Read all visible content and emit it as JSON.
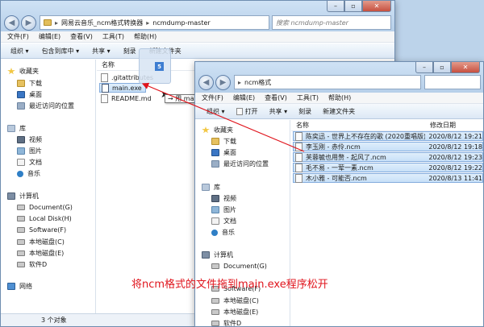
{
  "window_back": {
    "path": [
      "网易云音乐_ncm格式转换器",
      "ncmdump-master"
    ],
    "search_placeholder": "搜索 ncmdump-master",
    "menu": [
      "文件(F)",
      "编辑(E)",
      "查看(V)",
      "工具(T)",
      "帮助(H)"
    ],
    "toolbar": {
      "organize": "组织 ▾",
      "include": "包含到库中 ▾",
      "share": "共享 ▾",
      "burn": "刻录",
      "new_folder": "新建文件夹"
    },
    "column_name": "名称",
    "files": [
      ".gitattributes",
      "main.exe",
      "README.md"
    ],
    "nav": {
      "favorites": "收藏夹",
      "favorites_items": [
        "下载",
        "桌面",
        "最近访问的位置"
      ],
      "libraries": "库",
      "library_items": [
        "视频",
        "图片",
        "文档",
        "音乐"
      ],
      "computer": "计算机",
      "drives": [
        "Document(G)",
        "Local Disk(H)",
        "Software(F)",
        "本地磁盘(C)",
        "本地磁盘(E)",
        "软件D"
      ],
      "network": "网络"
    },
    "status": "3 个对象"
  },
  "window_front": {
    "path": "ncm格式",
    "menu": [
      "文件(F)",
      "编辑(E)",
      "查看(V)",
      "工具(T)",
      "帮助(H)"
    ],
    "toolbar": {
      "organize": "组织 ▾",
      "open": "打开",
      "share": "共享 ▾",
      "burn": "刻录",
      "new_folder": "新建文件夹"
    },
    "columns": {
      "name": "名称",
      "date": "修改日期"
    },
    "files": [
      {
        "name": "陈奕迅 - 世界上不存在的歌 (2020重唱版).ncm",
        "date": "2020/8/12 19:21"
      },
      {
        "name": "李玉刚 - 赤伶.ncm",
        "date": "2020/8/12 19:18"
      },
      {
        "name": "芙蓉毓也用赘 - 起风了.ncm",
        "date": "2020/8/12 19:23"
      },
      {
        "name": "毛不易 - 一荤一素.ncm",
        "date": "2020/8/12 19:22"
      },
      {
        "name": "木小雅 - 可能否.ncm",
        "date": "2020/8/13 11:41"
      }
    ],
    "nav": {
      "favorites": "收藏夹",
      "favorites_items": [
        "下载",
        "桌面",
        "最近访问的位置"
      ],
      "libraries": "库",
      "library_items": [
        "视频",
        "图片",
        "文档",
        "音乐"
      ],
      "computer": "计算机",
      "drives": [
        "Document(G)",
        "Software(F)",
        "本地磁盘(C)",
        "本地磁盘(E)",
        "软件D"
      ]
    }
  },
  "drag": {
    "badge": "5",
    "tooltip": "→ 用 main.exe 打开"
  },
  "annotation": "将ncm格式的文件拖到main.exe程序松开",
  "colors": {
    "annotation": "#e0141c",
    "arrow": "#e0141c",
    "selection": "#cce4f7"
  }
}
